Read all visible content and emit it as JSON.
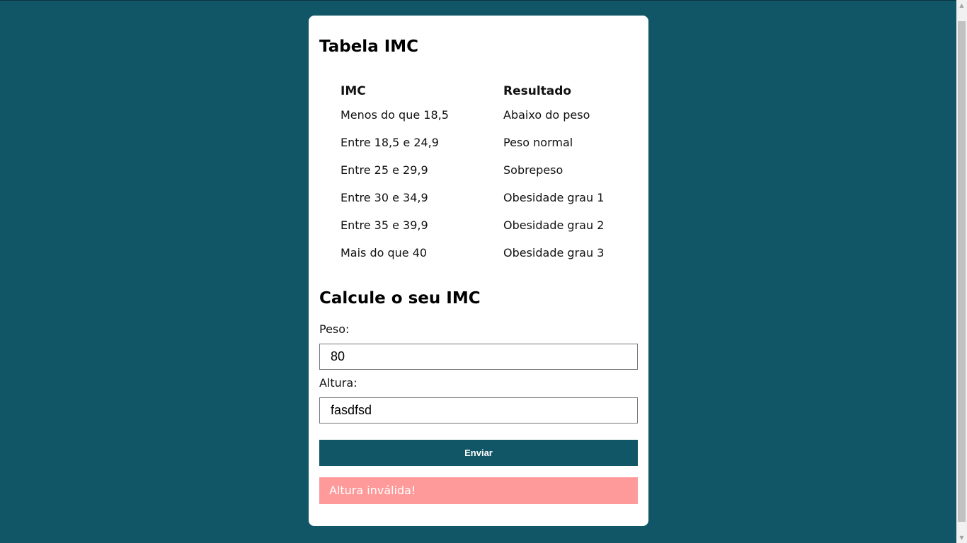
{
  "table_section": {
    "title": "Tabela IMC",
    "headers": [
      "IMC",
      "Resultado"
    ],
    "rows": [
      [
        "Menos do que 18,5",
        "Abaixo do peso"
      ],
      [
        "Entre 18,5 e 24,9",
        "Peso normal"
      ],
      [
        "Entre 25 e 29,9",
        "Sobrepeso"
      ],
      [
        "Entre 30 e 34,9",
        "Obesidade grau 1"
      ],
      [
        "Entre 35 e 39,9",
        "Obesidade grau 2"
      ],
      [
        "Mais do que 40",
        "Obesidade grau 3"
      ]
    ]
  },
  "form": {
    "title": "Calcule o seu IMC",
    "peso_label": "Peso:",
    "peso_value": "80",
    "altura_label": "Altura:",
    "altura_value": "fasdfsd",
    "submit_label": "Enviar",
    "error_message": "Altura inválida!"
  },
  "colors": {
    "background": "#115666",
    "button": "#115666",
    "error_background": "#ff9a9a"
  },
  "icons": {
    "scroll_up": "▲",
    "scroll_down": "▼"
  }
}
